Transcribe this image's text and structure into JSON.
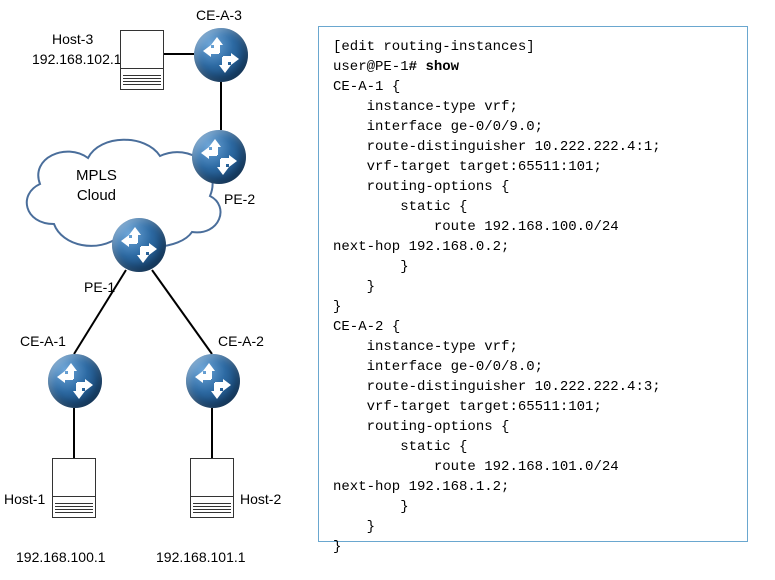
{
  "diagram": {
    "cloud_label_line1": "MPLS",
    "cloud_label_line2": "Cloud",
    "nodes": {
      "ce_a_3": "CE-A-3",
      "pe_2": "PE-2",
      "pe_1": "PE-1",
      "ce_a_1": "CE-A-1",
      "ce_a_2": "CE-A-2"
    },
    "hosts": {
      "h1": {
        "name": "Host-1",
        "ip": "192.168.100.1"
      },
      "h2": {
        "name": "Host-2",
        "ip": "192.168.101.1"
      },
      "h3": {
        "name": "Host-3",
        "ip": "192.168.102.1"
      }
    }
  },
  "config": {
    "context": "[edit routing-instances]",
    "prompt_user": "user@PE-1",
    "prompt_hash": "# ",
    "command": "show",
    "blocks": [
      {
        "name": "CE-A-1",
        "instance_type": "vrf",
        "interface": "ge-0/0/9.0",
        "rd": "10.222.222.4:1",
        "vrf_target": "target:65511:101",
        "static_route": "192.168.100.0/24",
        "next_hop": "192.168.0.2"
      },
      {
        "name": "CE-A-2",
        "instance_type": "vrf",
        "interface": "ge-0/0/8.0",
        "rd": "10.222.222.4:3",
        "vrf_target": "target:65511:101",
        "static_route": "192.168.101.0/24",
        "next_hop": "192.168.1.2"
      }
    ]
  }
}
